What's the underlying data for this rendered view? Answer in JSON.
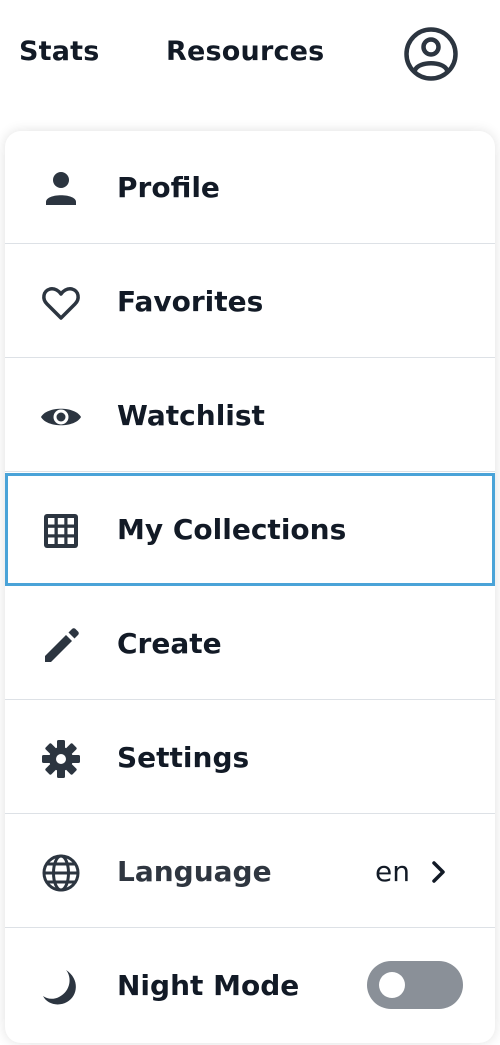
{
  "topbar": {
    "stats": "Stats",
    "resources": "Resources",
    "account_icon": "account-circle-icon"
  },
  "menu": {
    "items": [
      {
        "label": "Profile",
        "icon": "person-icon"
      },
      {
        "label": "Favorites",
        "icon": "heart-icon"
      },
      {
        "label": "Watchlist",
        "icon": "eye-icon"
      },
      {
        "label": "My Collections",
        "icon": "grid-icon",
        "focused": true
      },
      {
        "label": "Create",
        "icon": "pencil-icon"
      },
      {
        "label": "Settings",
        "icon": "gear-icon"
      },
      {
        "label": "Language",
        "icon": "globe-icon",
        "value": "en"
      },
      {
        "label": "Night Mode",
        "icon": "moon-icon",
        "toggle_on": false
      }
    ]
  },
  "colors": {
    "text": "#121a26",
    "focus_outline": "#4aa3d8",
    "toggle_off": "#8a9098",
    "divider": "#dde1e6"
  }
}
